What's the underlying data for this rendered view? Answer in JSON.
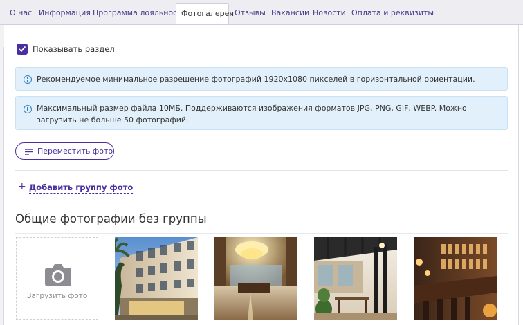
{
  "tabs": [
    {
      "label": "О нас",
      "active": false
    },
    {
      "label": "Информация",
      "active": false
    },
    {
      "label": "Программа лояльности",
      "active": false
    },
    {
      "label": "Фотогалерея",
      "active": true
    },
    {
      "label": "Отзывы",
      "active": false
    },
    {
      "label": "Вакансии",
      "active": false
    },
    {
      "label": "Новости",
      "active": false
    },
    {
      "label": "Оплата и реквизиты",
      "active": false
    }
  ],
  "show_section": {
    "label": "Показывать раздел",
    "checked": true
  },
  "info": [
    {
      "text": "Рекомендуемое минимальное разрешение фотографий 1920x1080 пикселей в горизонтальной ориентации."
    },
    {
      "text": "Максимальный размер файла 10МБ. Поддерживаются изображения форматов JPG, PNG, GIF, WEBP. Можно загрузить не больше 50 фотографий."
    }
  ],
  "move_photos_label": "Переместить фото",
  "add_group_label": "Добавить группу фото",
  "section_title": "Общие фотографии без группы",
  "upload_label": "Загрузить фото",
  "photos": [
    {
      "subject": "hotel-facade"
    },
    {
      "subject": "lobby-chandelier"
    },
    {
      "subject": "terrace-cafe"
    },
    {
      "subject": "bar-interior"
    }
  ],
  "colors": {
    "accent": "#4b2fa0",
    "info_bg": "#e1f0fa",
    "info_icon": "#2f7fc1",
    "tab_bg": "#eeeef2"
  }
}
